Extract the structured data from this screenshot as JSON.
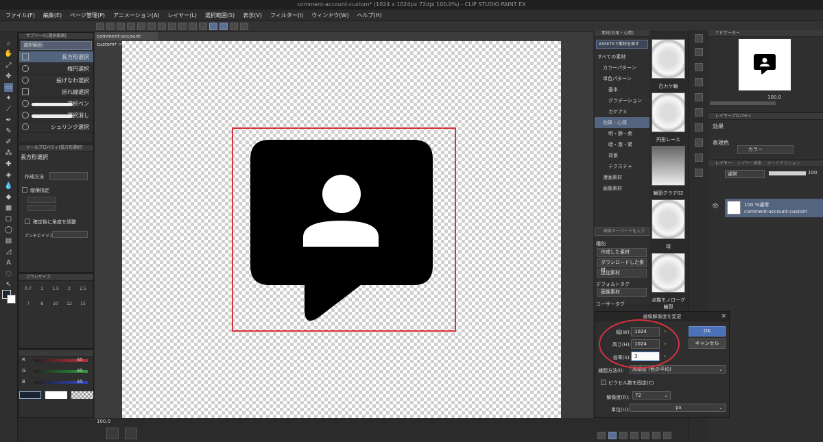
{
  "window": {
    "title": "comment-account-custom* (1024 x 1024px 72dpi 100.0%)  - CLIP STUDIO PAINT EX"
  },
  "menu": [
    "ファイル(F)",
    "編集(E)",
    "ページ管理(P)",
    "アニメーション(A)",
    "レイヤー(L)",
    "選択範囲(S)",
    "表示(V)",
    "フィルター(I)",
    "ウィンドウ(W)",
    "ヘルプ(H)"
  ],
  "document": {
    "tab_label": "comment-account-custom*",
    "zoom": "100.0"
  },
  "subtool": {
    "header": "サブツール[選択範囲]",
    "group": "選択範囲",
    "items": [
      "長方形選択",
      "楕円選択",
      "投げなわ選択",
      "折れ線選択",
      "選択ペン",
      "選択消し",
      "シュリンク選択"
    ]
  },
  "tool_property": {
    "header": "ツールプロパティ[長方形選択]",
    "title": "長方形選択",
    "method_label": "作成方法",
    "aspect_label": "縦横指定",
    "angle_label": "確定後に角度を調整",
    "antialias_label": "アンチエイリアス"
  },
  "brush_size": {
    "header": "ブラシサイズ",
    "sizes": [
      "0.7",
      "1",
      "1.5",
      "2",
      "2.5",
      "7",
      "8",
      "10",
      "12",
      "15",
      "17"
    ]
  },
  "color_slider": {
    "r_label": "R",
    "g_label": "G",
    "b_label": "B",
    "r": "45",
    "g": "45",
    "b": "45",
    "r_color": "#c0303a",
    "g_color": "#2f9e3a",
    "b_color": "#2e46c8"
  },
  "materials": {
    "header": "素材[効果・心情]",
    "assets_button": "ASSETSで素材を探す",
    "tree": [
      "すべての素材",
      "カラーパターン",
      "単色パターン",
      "基本",
      "グラデーション",
      "カケアミ",
      "効果・心情",
      "明・静・柔",
      "暗・激・緊",
      "背景",
      "テクスチャ",
      "漫画素材",
      "画像素材"
    ],
    "search_placeholder": "検索キーワードを入力",
    "kind_label": "種別",
    "filters": [
      "作成した素材",
      "ダウンロードした素材",
      "追加素材"
    ],
    "default_tag_label": "デフォルトタグ",
    "default_tag": "画像素材",
    "user_tag_label": "ユーザータグ",
    "thumbs": [
      "白カケ輪",
      "円形レース",
      "輪郭グラデ02",
      "球",
      "点描モノローグ輪郭"
    ]
  },
  "navigator": {
    "header": "ナビゲーター",
    "zoom": "100.0"
  },
  "layer_property": {
    "header": "レイヤープロパティ",
    "effect_label": "効果",
    "color_label": "表現色",
    "color_value": "カラー"
  },
  "layers": {
    "tabs": [
      "レイヤー",
      "レイヤー検索",
      "オートアクション"
    ],
    "blend": "通常",
    "opacity": "100",
    "layer_opacity_mode": "100 %通常",
    "layer_name": "comment-account-custom"
  },
  "dialog": {
    "title": "画像解像度を変更",
    "width_label": "幅(W):",
    "width_value": "1024",
    "height_label": "高さ(H):",
    "height_value": "1024",
    "scale_label": "倍率(S):",
    "scale_value": "3",
    "ok": "OK",
    "cancel": "キャンセル",
    "interp_label": "補間方法(I):",
    "interp_value": "高精度 (色の平均)",
    "fix_pixels_label": "ピクセル数を固定(C)",
    "resolution_label": "解像度(R):",
    "resolution_value": "72",
    "unit_label": "単位(U):",
    "unit_value": "px"
  }
}
